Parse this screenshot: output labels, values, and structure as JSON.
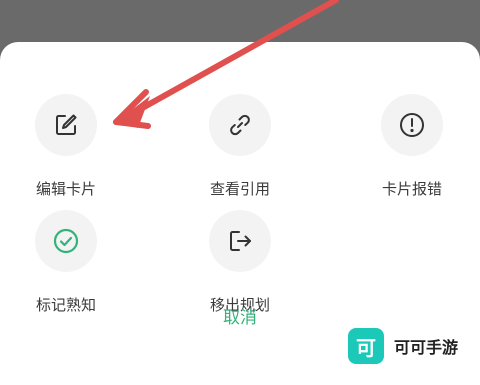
{
  "actions": [
    {
      "label": "编辑卡片",
      "icon": "edit-icon"
    },
    {
      "label": "查看引用",
      "icon": "link-icon"
    },
    {
      "label": "卡片报错",
      "icon": "error-icon"
    },
    {
      "label": "标记熟知",
      "icon": "check-circle-icon"
    },
    {
      "label": "移出规划",
      "icon": "exit-icon"
    }
  ],
  "cancel_label": "取消",
  "watermark": {
    "logo_char": "可",
    "text": "可可手游"
  },
  "colors": {
    "accent": "#33b27b",
    "overlay": "#6b6b6b",
    "annotation_arrow": "#e0504e",
    "watermark_bg": "#1cc8b7"
  }
}
